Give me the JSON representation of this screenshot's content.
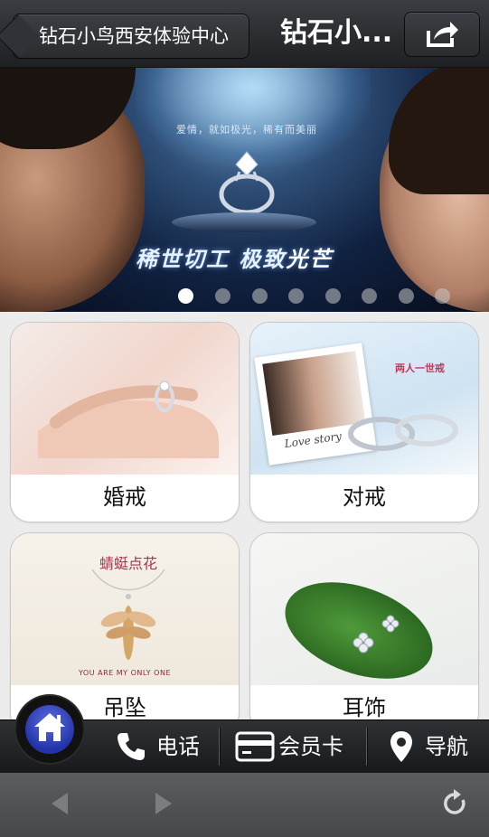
{
  "header": {
    "back_label": "钻石小鸟西安体验中心",
    "title": "钻石小...",
    "share_icon": "share-icon"
  },
  "banner": {
    "tagline": "爱情，就如极光，稀有而美丽",
    "slogan_part1": "稀世切工 极致",
    "slogan_part2": "光芒",
    "slide_count": 8,
    "active_slide": 1
  },
  "categories": [
    {
      "label": "婚戒"
    },
    {
      "label": "对戒"
    },
    {
      "label": "吊坠"
    },
    {
      "label": "耳饰"
    }
  ],
  "card_images": {
    "couple_title": "两人一世戒",
    "love_story": "Love story",
    "pendant_title": "蜻蜓点花",
    "pendant_caption": "YOU ARE MY ONLY ONE"
  },
  "bottom_nav": {
    "home_icon": "home-icon",
    "phone": {
      "label": "电话",
      "icon": "phone-icon"
    },
    "card": {
      "label": "会员卡",
      "icon": "card-icon"
    },
    "nav": {
      "label": "导航",
      "icon": "location-pin-icon"
    }
  },
  "browser": {
    "back_icon": "arrow-left-icon",
    "forward_icon": "arrow-right-icon",
    "refresh_icon": "refresh-icon"
  },
  "colors": {
    "topbar": "#2a2c2f",
    "home_button": "#2332a8",
    "page_bg": "#ececec"
  }
}
